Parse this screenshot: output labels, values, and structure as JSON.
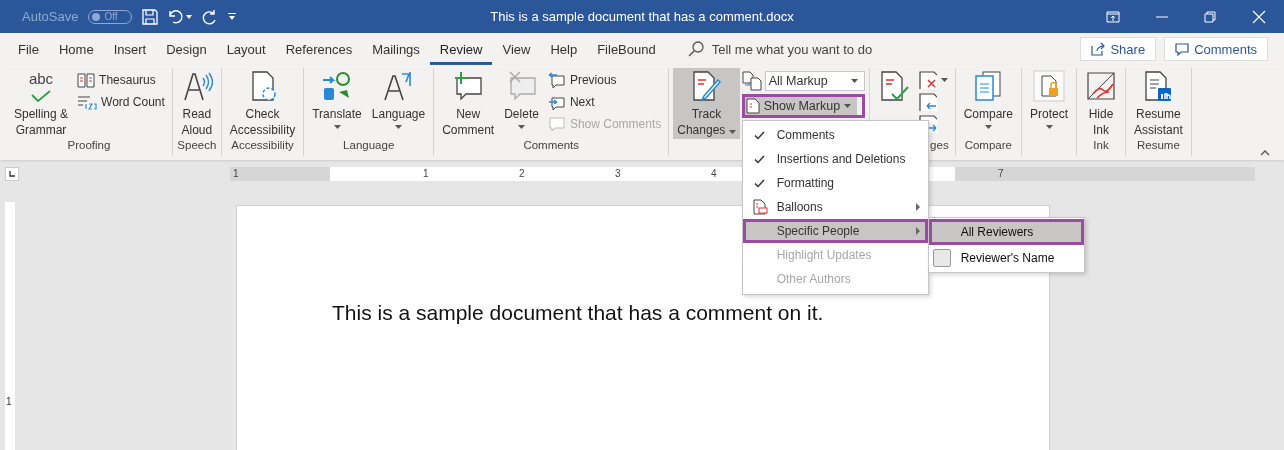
{
  "title_bar": {
    "autosave_label": "AutoSave",
    "autosave_toggle": {
      "label": "Off",
      "on": false
    },
    "title": "This is a sample document that has a comment.docx"
  },
  "tabs": [
    {
      "label": "File",
      "selected": false
    },
    {
      "label": "Home",
      "selected": false
    },
    {
      "label": "Insert",
      "selected": false
    },
    {
      "label": "Design",
      "selected": false
    },
    {
      "label": "Layout",
      "selected": false
    },
    {
      "label": "References",
      "selected": false
    },
    {
      "label": "Mailings",
      "selected": false
    },
    {
      "label": "Review",
      "selected": true
    },
    {
      "label": "View",
      "selected": false
    },
    {
      "label": "Help",
      "selected": false
    },
    {
      "label": "FileBound",
      "selected": false
    }
  ],
  "tell_me": {
    "placeholder": "Tell me what you want to do"
  },
  "share_button": "Share",
  "comments_button": "Comments",
  "ribbon_groups": [
    {
      "label": "Proofing",
      "items": [
        {
          "kind": "large",
          "label": "Spelling &\nGrammar",
          "icon_text": "abc"
        },
        {
          "kind": "small",
          "label": "Thesaurus"
        },
        {
          "kind": "small",
          "label": "Word Count"
        }
      ]
    },
    {
      "label": "Speech",
      "items": [
        {
          "kind": "large",
          "label": "Read\nAloud"
        }
      ]
    },
    {
      "label": "Accessibility",
      "items": [
        {
          "kind": "large",
          "label": "Check\nAccessibility"
        }
      ]
    },
    {
      "label": "Language",
      "items": [
        {
          "kind": "large",
          "label": "Translate",
          "dropdown": true
        },
        {
          "kind": "large",
          "label": "Language",
          "dropdown": true
        }
      ]
    },
    {
      "label": "Comments",
      "items": [
        {
          "kind": "large",
          "label": "New\nComment"
        },
        {
          "kind": "large",
          "label": "Delete",
          "dropdown": true
        },
        {
          "kind": "small",
          "label": "Previous",
          "disabled": false
        },
        {
          "kind": "small",
          "label": "Next",
          "disabled": false
        },
        {
          "kind": "small",
          "label": "Show Comments",
          "disabled": true
        }
      ]
    },
    {
      "items": [
        {
          "kind": "split",
          "label": "Track\nChanges",
          "dropdown": true,
          "selected": true
        },
        {
          "kind": "select",
          "value": "All Markup"
        },
        {
          "kind": "menu-button",
          "label": "Show Markup",
          "open": true,
          "highlighted": true
        }
      ]
    },
    {
      "label": "ges",
      "items": [
        {
          "kind": "large"
        },
        {
          "kind": "icon",
          "dropdown": true
        },
        {
          "kind": "icon"
        },
        {
          "kind": "icon"
        }
      ]
    },
    {
      "label": "Compare",
      "items": [
        {
          "kind": "large",
          "label": "Compare",
          "dropdown": true
        }
      ]
    },
    {
      "items": [
        {
          "kind": "large",
          "label": "Protect",
          "dropdown": true
        }
      ]
    },
    {
      "label": "Ink",
      "items": [
        {
          "kind": "large",
          "label": "Hide\nInk"
        }
      ]
    },
    {
      "label": "Resume",
      "items": [
        {
          "kind": "large",
          "label": "Resume\nAssistant"
        }
      ]
    }
  ],
  "show_markup_menu": [
    {
      "kind": "check",
      "label": "Comments",
      "checked": true,
      "selected": false,
      "disabled": false
    },
    {
      "kind": "check",
      "label": "Insertions and Deletions",
      "checked": true,
      "selected": false,
      "disabled": false
    },
    {
      "kind": "check",
      "label": "Formatting",
      "checked": true,
      "selected": false,
      "disabled": false
    },
    {
      "kind": "icon",
      "label": "Balloons",
      "submenu": true,
      "selected": false,
      "disabled": false
    },
    {
      "kind": "check",
      "label": "Specific People",
      "checked": false,
      "submenu": true,
      "selected": true,
      "highlighted": true,
      "disabled": false
    },
    {
      "kind": "check",
      "label": "Highlight Updates",
      "checked": false,
      "selected": false,
      "disabled": true
    },
    {
      "kind": "check",
      "label": "Other Authors",
      "checked": false,
      "selected": false,
      "disabled": true
    }
  ],
  "specific_people_menu": [
    {
      "kind": "plain",
      "label": "All Reviewers",
      "selected": true,
      "highlighted": true
    },
    {
      "kind": "checkbox",
      "label": "Reviewer's Name",
      "checked": false,
      "selected": false
    }
  ],
  "ruler": {
    "left_label": "1",
    "labels": [
      "1",
      "2",
      "3",
      "4"
    ],
    "right_label": "7"
  },
  "vertical_ruler": {
    "label": "1"
  },
  "document": {
    "text": "This is a sample document that has a comment on it."
  }
}
